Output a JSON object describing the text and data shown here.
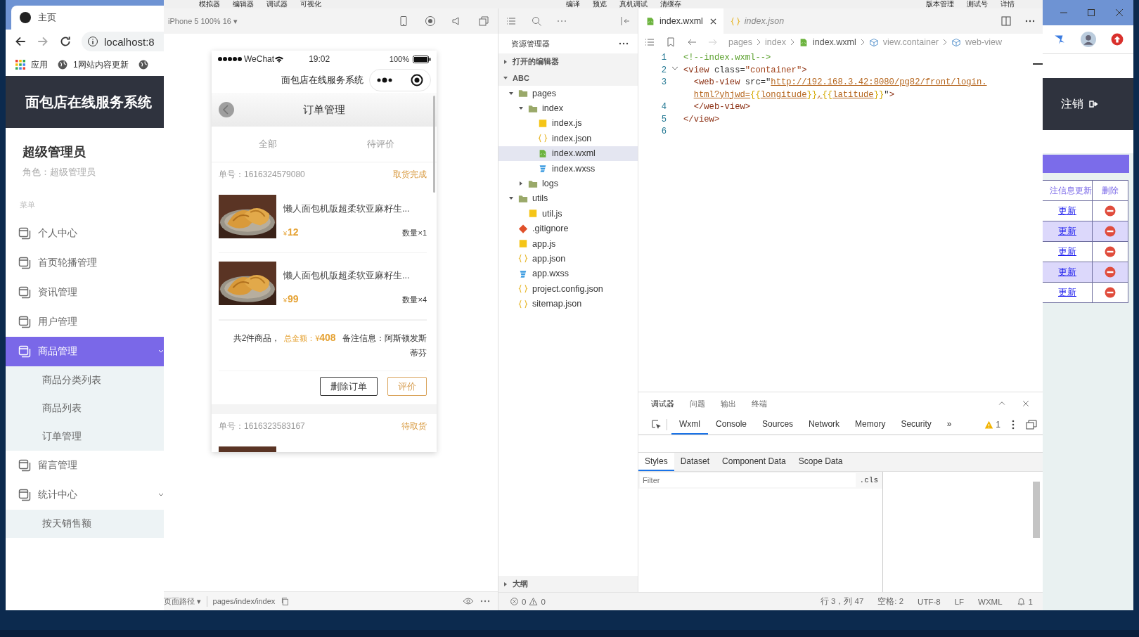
{
  "browser": {
    "tab_title": "主页",
    "address": "localhost:8",
    "bookmarks": [
      "应用",
      "1网站内容更新"
    ],
    "header_title": "面包店在线服务系统",
    "logout": "注销",
    "admin": {
      "name": "超级管理员",
      "role": "角色：超级管理员"
    },
    "menu_label": "菜单",
    "menu": [
      {
        "label": "个人中心",
        "selected": false
      },
      {
        "label": "首页轮播管理",
        "selected": false
      },
      {
        "label": "资讯管理",
        "selected": false
      },
      {
        "label": "用户管理",
        "selected": false
      },
      {
        "label": "商品管理",
        "selected": true,
        "expanded": true,
        "children": [
          {
            "label": "商品分类列表",
            "selected": false
          },
          {
            "label": "商品列表",
            "selected": false
          },
          {
            "label": "订单管理",
            "selected": false
          }
        ]
      },
      {
        "label": "留言管理",
        "selected": false
      },
      {
        "label": "统计中心",
        "selected": false,
        "expanded": true,
        "children": [
          {
            "label": "按天销售额",
            "selected": false
          }
        ]
      }
    ],
    "table": {
      "columns": [
        "注信息更新",
        "删除"
      ],
      "rows": [
        {
          "link": "更新"
        },
        {
          "link": "更新"
        },
        {
          "link": "更新"
        },
        {
          "link": "更新"
        },
        {
          "link": "更新"
        }
      ]
    }
  },
  "ide": {
    "menu": [
      "模拟器",
      "编辑器",
      "调试器",
      "可视化"
    ],
    "actions": [
      "编译",
      "预览",
      "真机调试",
      "清缓存"
    ],
    "right_actions": [
      "版本管理",
      "测试号",
      "详情"
    ],
    "simulator": {
      "device": "iPhone 5 100% 16 ▾",
      "path_label": "页面路径 ▾",
      "path": "pages/index/index",
      "phone": {
        "carrier": "WeChat",
        "time": "19:02",
        "battery": "100%",
        "app_title": "面包店在线服务系统",
        "page_title": "订单管理",
        "tabs": [
          {
            "label": "全部",
            "selected": false
          },
          {
            "label": "待评价",
            "selected": false
          }
        ],
        "orders": [
          {
            "number": "单号：1616324579080",
            "status": "取货完成",
            "items": [
              {
                "kind": "product",
                "name": "懒人面包机版超柔软亚麻籽生...",
                "currency": "¥",
                "price": "12",
                "quantity": "数量×1"
              },
              {
                "kind": "product",
                "name": "懒人面包机版超柔软亚麻籽生...",
                "currency": "¥",
                "price": "99",
                "quantity": "数量×4"
              }
            ],
            "summary": {
              "count": "共2件商品，",
              "total_label": "总金额：¥",
              "total": "408",
              "note": "备注信息：阿斯顿发斯蒂芬"
            },
            "buttons": [
              {
                "label": "删除订单",
                "kind": "plain"
              },
              {
                "label": "评价",
                "kind": "accent"
              }
            ]
          },
          {
            "number": "单号：1616323583167",
            "status": "待取货"
          }
        ]
      }
    },
    "explorer": {
      "title": "资源管理器",
      "outline": "大纲",
      "sections": [
        {
          "label": "打开的编辑器",
          "expanded": false
        },
        {
          "label": "ABC",
          "expanded": true,
          "children": [
            {
              "label": "pages",
              "kind": "folder",
              "selected": false,
              "expanded": true,
              "children": [
                {
                  "label": "index",
                  "kind": "folder",
                  "selected": false,
                  "expanded": true,
                  "children": [
                    {
                      "label": "index.js",
                      "kind": "js",
                      "selected": false
                    },
                    {
                      "label": "index.json",
                      "kind": "json",
                      "selected": false
                    },
                    {
                      "label": "index.wxml",
                      "kind": "wxml",
                      "selected": true
                    },
                    {
                      "label": "index.wxss",
                      "kind": "wxss",
                      "selected": false
                    }
                  ]
                },
                {
                  "label": "logs",
                  "kind": "folder",
                  "selected": false,
                  "expanded": false
                }
              ]
            },
            {
              "label": "utils",
              "kind": "folder",
              "selected": false,
              "expanded": true,
              "children": [
                {
                  "label": "util.js",
                  "kind": "js",
                  "selected": false
                }
              ]
            },
            {
              "label": ".gitignore",
              "kind": "git",
              "selected": false
            },
            {
              "label": "app.js",
              "kind": "js",
              "selected": false
            },
            {
              "label": "app.json",
              "kind": "json",
              "selected": false
            },
            {
              "label": "app.wxss",
              "kind": "wxss",
              "selected": false
            },
            {
              "label": "project.config.json",
              "kind": "json",
              "selected": false
            },
            {
              "label": "sitemap.json",
              "kind": "json",
              "selected": false
            }
          ]
        }
      ]
    },
    "editor": {
      "tabs": [
        {
          "label": "index.wxml",
          "kind": "wxml",
          "selected": true
        },
        {
          "label": "index.json",
          "kind": "json",
          "selected": false
        }
      ],
      "breadcrumb": [
        {
          "label": "pages",
          "kind": "plain"
        },
        {
          "label": "index",
          "kind": "plain"
        },
        {
          "label": "index.wxml",
          "kind": "wxml"
        },
        {
          "label": "view.container",
          "kind": "element"
        },
        {
          "label": "web-view",
          "kind": "element"
        }
      ],
      "lines": [
        {
          "number": "1",
          "foldable": false,
          "tokens": [
            {
              "kind": "comment",
              "text": "<!--index.wxml-->"
            }
          ]
        },
        {
          "number": "2",
          "foldable": true,
          "tokens": [
            {
              "kind": "tag",
              "text": "<view"
            },
            {
              "kind": "attr",
              "text": " class="
            },
            {
              "kind": "string",
              "text": "\"container\""
            },
            {
              "kind": "tag",
              "text": ">"
            }
          ]
        },
        {
          "number": "3",
          "foldable": false,
          "tokens": [
            {
              "kind": "tag",
              "text": "  <web-view"
            },
            {
              "kind": "attr",
              "text": " src=\""
            },
            {
              "kind": "link",
              "text": "http://192.168.3.42:8080/pg82/front/login.html?yhjwd="
            },
            {
              "kind": "brace",
              "text": "{{"
            },
            {
              "kind": "link",
              "text": "longitude"
            },
            {
              "kind": "brace",
              "text": "}}"
            },
            {
              "kind": "link",
              "text": ","
            },
            {
              "kind": "brace",
              "text": "{{"
            },
            {
              "kind": "link",
              "text": "latitude"
            },
            {
              "kind": "brace",
              "text": "}}"
            },
            {
              "kind": "attr",
              "text": "\""
            },
            {
              "kind": "tag",
              "text": ">"
            }
          ]
        },
        {
          "number": "4",
          "foldable": false,
          "tokens": [
            {
              "kind": "tag",
              "text": "  </web-view>"
            }
          ]
        },
        {
          "number": "5",
          "foldable": false,
          "tokens": [
            {
              "kind": "tag",
              "text": "</view>"
            }
          ]
        },
        {
          "number": "6",
          "foldable": false
        }
      ]
    },
    "devtools": {
      "tabs": [
        {
          "label": "调试器",
          "selected": true
        },
        {
          "label": "问题",
          "selected": false
        },
        {
          "label": "输出",
          "selected": false
        },
        {
          "label": "终端",
          "selected": false
        }
      ],
      "panels": [
        {
          "label": "Wxml",
          "selected": true
        },
        {
          "label": "Console",
          "selected": false
        },
        {
          "label": "Sources",
          "selected": false
        },
        {
          "label": "Network",
          "selected": false
        },
        {
          "label": "Memory",
          "selected": false
        },
        {
          "label": "Security",
          "selected": false
        }
      ],
      "more": "»",
      "warnings": "1",
      "subtabs": [
        {
          "label": "Styles",
          "selected": true
        },
        {
          "label": "Dataset",
          "selected": false
        },
        {
          "label": "Component Data",
          "selected": false
        },
        {
          "label": "Scope Data",
          "selected": false
        }
      ],
      "filter_placeholder": "Filter",
      "cls": ".cls"
    },
    "status": {
      "errors": "0",
      "warnings": "0",
      "items": [
        "行 3，列 47",
        "空格: 2",
        "UTF-8",
        "LF",
        "WXML"
      ],
      "notifications": "1"
    }
  }
}
